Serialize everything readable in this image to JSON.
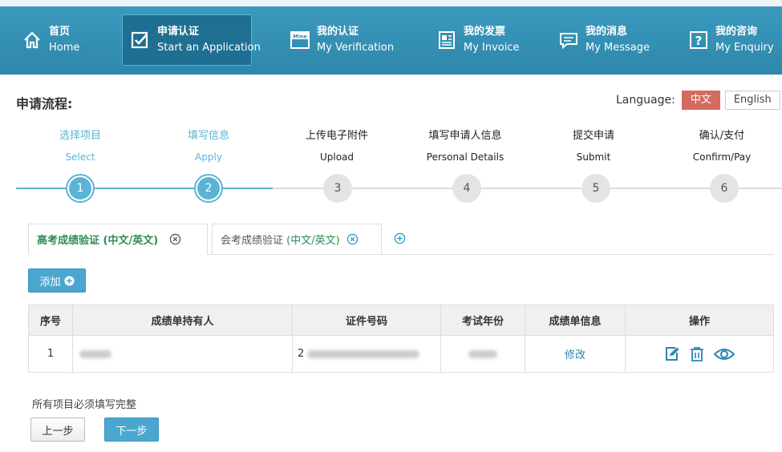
{
  "nav": {
    "items": [
      {
        "cn": "首页",
        "en": "Home",
        "icon": "home-icon"
      },
      {
        "cn": "申请认证",
        "en": "Start an Application",
        "icon": "checkbox-icon",
        "active": true
      },
      {
        "cn": "我的认证",
        "en": "My Verification",
        "icon": "mine-icon"
      },
      {
        "cn": "我的发票",
        "en": "My Invoice",
        "icon": "invoice-icon"
      },
      {
        "cn": "我的消息",
        "en": "My Message",
        "icon": "message-icon"
      },
      {
        "cn": "我的咨询",
        "en": "My Enquiry",
        "icon": "enquiry-icon"
      }
    ]
  },
  "process": {
    "title": "申请流程:",
    "language_label": "Language:",
    "lang_cn": "中文",
    "lang_en": "English",
    "steps": [
      {
        "cn": "选择项目",
        "en": "Select",
        "num": "1",
        "done": true
      },
      {
        "cn": "填写信息",
        "en": "Apply",
        "num": "2",
        "done": true
      },
      {
        "cn": "上传电子附件",
        "en": "Upload",
        "num": "3",
        "done": false
      },
      {
        "cn": "填写申请人信息",
        "en": "Personal Details",
        "num": "4",
        "done": false
      },
      {
        "cn": "提交申请",
        "en": "Submit",
        "num": "5",
        "done": false
      },
      {
        "cn": "确认/支付",
        "en": "Confirm/Pay",
        "num": "6",
        "done": false
      }
    ]
  },
  "tabs": [
    {
      "label": "高考成绩验证 ",
      "paren": "(中文/英文)",
      "active": true
    },
    {
      "label": "会考成绩验证 ",
      "paren": "(中文/英文)",
      "active": false
    }
  ],
  "add_button": "添加",
  "table": {
    "headers": [
      "序号",
      "成绩单持有人",
      "证件号码",
      "考试年份",
      "成绩单信息",
      "操作"
    ],
    "rows": [
      {
        "index": "1",
        "holder": "",
        "id_prefix": "2",
        "year": "",
        "info_link": "修改"
      }
    ]
  },
  "footer": {
    "note": "所有项目必须填写完整",
    "prev": "上一步",
    "next": "下一步"
  },
  "colors": {
    "nav_bg": "#2d87ab",
    "active_step": "#5bb3d6",
    "lang_active": "#d36b5e",
    "button_primary": "#4ba7cf",
    "tab_green": "#2e8b57"
  }
}
